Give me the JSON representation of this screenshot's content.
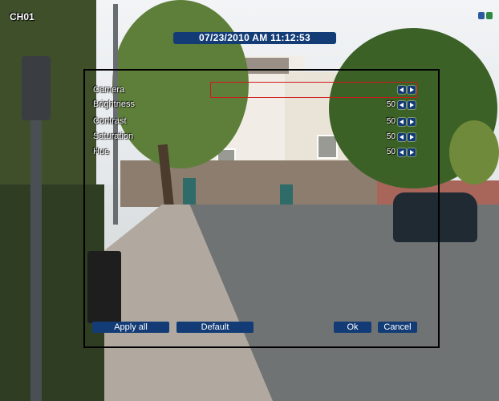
{
  "osd": {
    "channel": "CH01",
    "datetime": "07/23/2010  AM 11:12:53"
  },
  "settings": {
    "rows": [
      {
        "label": "Camera",
        "value": ""
      },
      {
        "label": "Brightness",
        "value": "50"
      },
      {
        "label": "Contrast",
        "value": "50"
      },
      {
        "label": "Saturation",
        "value": "50"
      },
      {
        "label": "Hue",
        "value": "50"
      }
    ]
  },
  "buttons": {
    "apply_all": "Apply all",
    "default": "Default",
    "ok": "Ok",
    "cancel": "Cancel"
  },
  "colors": {
    "accent": "#133c76",
    "selection": "#d01818",
    "panel_border": "#000000"
  },
  "icons": {
    "status": [
      "record-status-icon",
      "network-status-icon"
    ],
    "row_controls": [
      "arrow-left-icon",
      "arrow-right-icon"
    ]
  }
}
